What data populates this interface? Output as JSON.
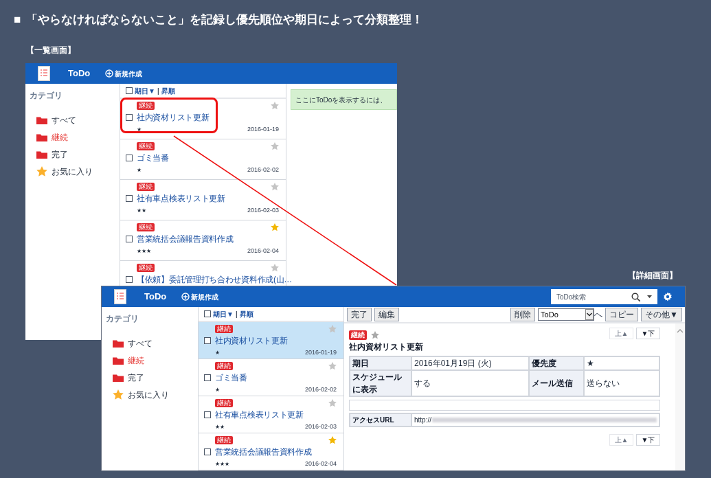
{
  "heading": {
    "bullet": "■",
    "text": "「やらなければならないこと」を記録し優先順位や期日によって分類整理！"
  },
  "list_screen": {
    "label": "【一覧画面】",
    "app_title": "ToDo",
    "new_button": "新規作成",
    "sidebar_title": "カテゴリ",
    "categories": [
      {
        "kind": "folder",
        "label": "すべて",
        "selected": false
      },
      {
        "kind": "folder",
        "label": "継続",
        "selected": true
      },
      {
        "kind": "folder",
        "label": "完了",
        "selected": false
      },
      {
        "kind": "star",
        "label": "お気に入り",
        "selected": false
      }
    ],
    "sort": {
      "checked": false,
      "key": "期日▼",
      "separator": "|",
      "order": "昇順"
    },
    "message": "ここにToDoを表示するには、",
    "items": [
      {
        "tag": "継続",
        "title": "社内資材リスト更新",
        "priority": "★",
        "date": "2016-01-19",
        "favorite": false,
        "checked": false,
        "highlighted": true,
        "selected": false
      },
      {
        "tag": "継続",
        "title": "ゴミ当番",
        "priority": "★",
        "date": "2016-02-02",
        "favorite": false,
        "checked": false,
        "highlighted": false,
        "selected": false
      },
      {
        "tag": "継続",
        "title": "社有車点検表リスト更新",
        "priority": "★★",
        "date": "2016-02-03",
        "favorite": false,
        "checked": false,
        "highlighted": false,
        "selected": false
      },
      {
        "tag": "継続",
        "title": "営業統括会議報告資料作成",
        "priority": "★★★",
        "date": "2016-02-04",
        "favorite": true,
        "checked": false,
        "highlighted": false,
        "selected": false
      },
      {
        "tag": "継続",
        "title": "【依頼】委託管理打ち合わせ資料作成(山…",
        "favorite": false,
        "checked": false,
        "highlighted": false,
        "selected": false
      }
    ]
  },
  "detail_screen": {
    "label": "【詳細画面】",
    "app_title": "ToDo",
    "new_button": "新規作成",
    "search_placeholder": "ToDo検索",
    "sidebar_title": "カテゴリ",
    "categories": [
      {
        "kind": "folder",
        "label": "すべて",
        "selected": false
      },
      {
        "kind": "folder",
        "label": "継続",
        "selected": true
      },
      {
        "kind": "folder",
        "label": "完了",
        "selected": false
      },
      {
        "kind": "star",
        "label": "お気に入り",
        "selected": false
      }
    ],
    "sort": {
      "checked": false,
      "key": "期日▼",
      "separator": "|",
      "order": "昇順"
    },
    "items": [
      {
        "tag": "継続",
        "title": "社内資材リスト更新",
        "priority": "★",
        "date": "2016-01-19",
        "favorite": false,
        "checked": false,
        "highlighted": false,
        "selected": true
      },
      {
        "tag": "継続",
        "title": "ゴミ当番",
        "priority": "★",
        "date": "2016-02-02",
        "favorite": false,
        "checked": false,
        "highlighted": false,
        "selected": false
      },
      {
        "tag": "継続",
        "title": "社有車点検表リスト更新",
        "priority": "★★",
        "date": "2016-02-03",
        "favorite": false,
        "checked": false,
        "highlighted": false,
        "selected": false
      },
      {
        "tag": "継続",
        "title": "営業統括会議報告資料作成",
        "priority": "★★★",
        "date": "2016-02-04",
        "favorite": true,
        "checked": false,
        "highlighted": false,
        "selected": false
      }
    ],
    "toolbar": {
      "left_buttons": [
        "完了",
        "編集"
      ],
      "delete_button": "削除",
      "move_select": "ToDo",
      "move_label": "へ",
      "copy_button": "コピー",
      "more_button": "その他▼"
    },
    "detail": {
      "tag": "継続",
      "favorite": false,
      "title": "社内資材リスト更新",
      "nav_top": [
        {
          "label": "上▲",
          "disabled": true
        },
        {
          "label": "▼下",
          "disabled": false
        }
      ],
      "fields": [
        {
          "label": "期日",
          "value": "2016年01月19日 (火)",
          "label2": "優先度",
          "value2": "★"
        },
        {
          "label": "スケジュールに表示",
          "value": "する",
          "label2": "メール送信",
          "value2": "送らない"
        }
      ],
      "url_label": "アクセスURL",
      "url_value": "http://",
      "nav_bottom": [
        {
          "label": "上▲",
          "disabled": true
        },
        {
          "label": "▼下",
          "disabled": false
        }
      ]
    }
  }
}
